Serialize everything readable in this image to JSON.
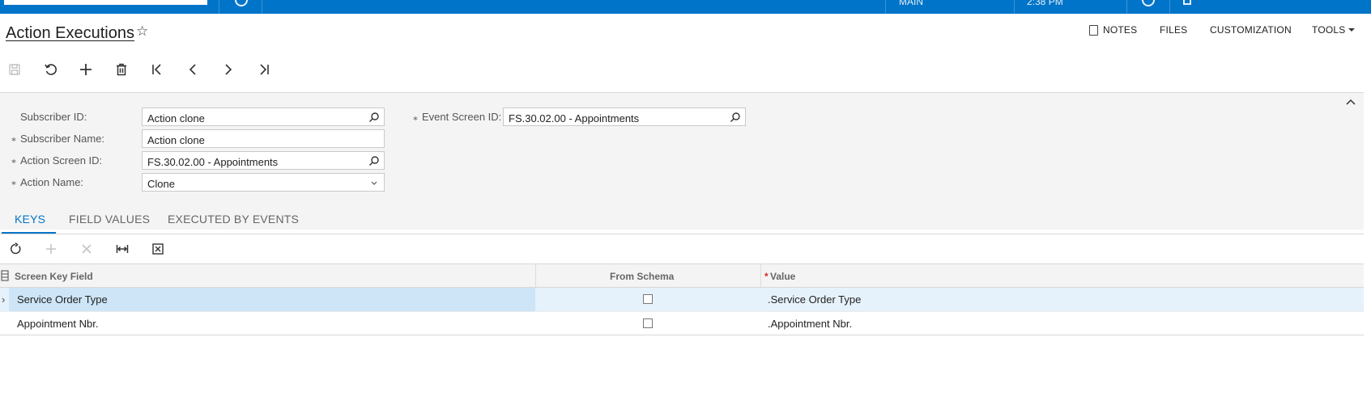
{
  "topbar": {
    "branch": "MAIN",
    "time": "2:38 PM"
  },
  "page": {
    "title": "Action Executions"
  },
  "header_actions": {
    "notes": "NOTES",
    "files": "FILES",
    "customization": "CUSTOMIZATION",
    "tools": "TOOLS"
  },
  "toolbar_icons": [
    "save-icon",
    "undo-icon",
    "add-icon",
    "delete-icon",
    "first-icon",
    "previous-icon",
    "next-icon",
    "last-icon"
  ],
  "form": {
    "subscriber_id": {
      "label": "Subscriber ID:",
      "value": "Action clone"
    },
    "subscriber_name": {
      "label": "Subscriber Name:",
      "value": "Action clone"
    },
    "action_screen_id": {
      "label": "Action Screen ID:",
      "value": "FS.30.02.00 - Appointments"
    },
    "action_name": {
      "label": "Action Name:",
      "value": "Clone"
    },
    "event_screen_id": {
      "label": "Event Screen ID:",
      "value": "FS.30.02.00 - Appointments"
    }
  },
  "tabs": [
    {
      "label": "KEYS"
    },
    {
      "label": "FIELD VALUES"
    },
    {
      "label": "EXECUTED BY EVENTS"
    }
  ],
  "grid": {
    "columns": {
      "screen_key_field": "Screen Key Field",
      "from_schema": "From Schema",
      "value": "Value"
    },
    "rows": [
      {
        "screen_key_field": "Service Order Type",
        "from_schema": false,
        "value": ".Service Order Type"
      },
      {
        "screen_key_field": "Appointment Nbr.",
        "from_schema": false,
        "value": ".Appointment Nbr."
      }
    ]
  },
  "colors": {
    "accent": "#0074c8",
    "selected_row": "#cde5f7",
    "required": "#d9251c"
  }
}
